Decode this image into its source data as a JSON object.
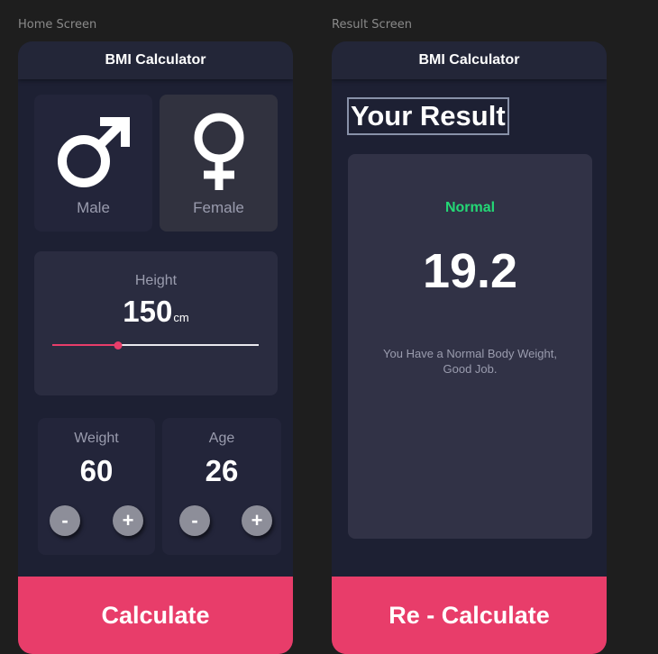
{
  "frames": {
    "home_label": "Home Screen",
    "result_label": "Result Screen"
  },
  "home": {
    "app_title": "BMI Calculator",
    "gender": {
      "male_label": "Male",
      "female_label": "Female",
      "male_icon": "male-symbol-icon",
      "female_icon": "female-symbol-icon"
    },
    "height": {
      "label": "Height",
      "value": "150",
      "unit": "cm",
      "slider_fraction": 0.32
    },
    "weight": {
      "label": "Weight",
      "value": "60",
      "minus": "-",
      "plus": "+"
    },
    "age": {
      "label": "Age",
      "value": "26",
      "minus": "-",
      "plus": "+"
    },
    "calculate_label": "Calculate"
  },
  "result": {
    "app_title": "BMI Calculator",
    "heading": "Your Result",
    "status": "Normal",
    "bmi": "19.2",
    "message": "You Have a Normal Body Weight, Good Job.",
    "recalculate_label": "Re - Calculate"
  },
  "colors": {
    "background": "#1e1e1e",
    "screen": "#1d2033",
    "card": "#282a3e",
    "accent": "#e83d6a",
    "status_green": "#24d876",
    "button_grey": "#8d8e99"
  }
}
